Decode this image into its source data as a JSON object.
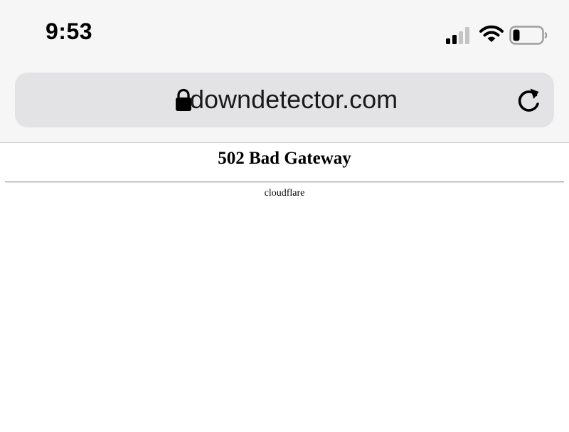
{
  "status_bar": {
    "time": "9:53",
    "icons": [
      "cellular-signal-icon",
      "wifi-icon",
      "battery-icon"
    ]
  },
  "address_bar": {
    "url": "downdetector.com",
    "icons": [
      "lock-icon",
      "reload-icon"
    ]
  },
  "page": {
    "heading": "502 Bad Gateway",
    "server": "cloudflare"
  },
  "colors": {
    "chrome_background": "#f6f6f6",
    "address_bar_background": "#e3e3e5",
    "page_background": "#ffffff",
    "text": "#000000"
  }
}
